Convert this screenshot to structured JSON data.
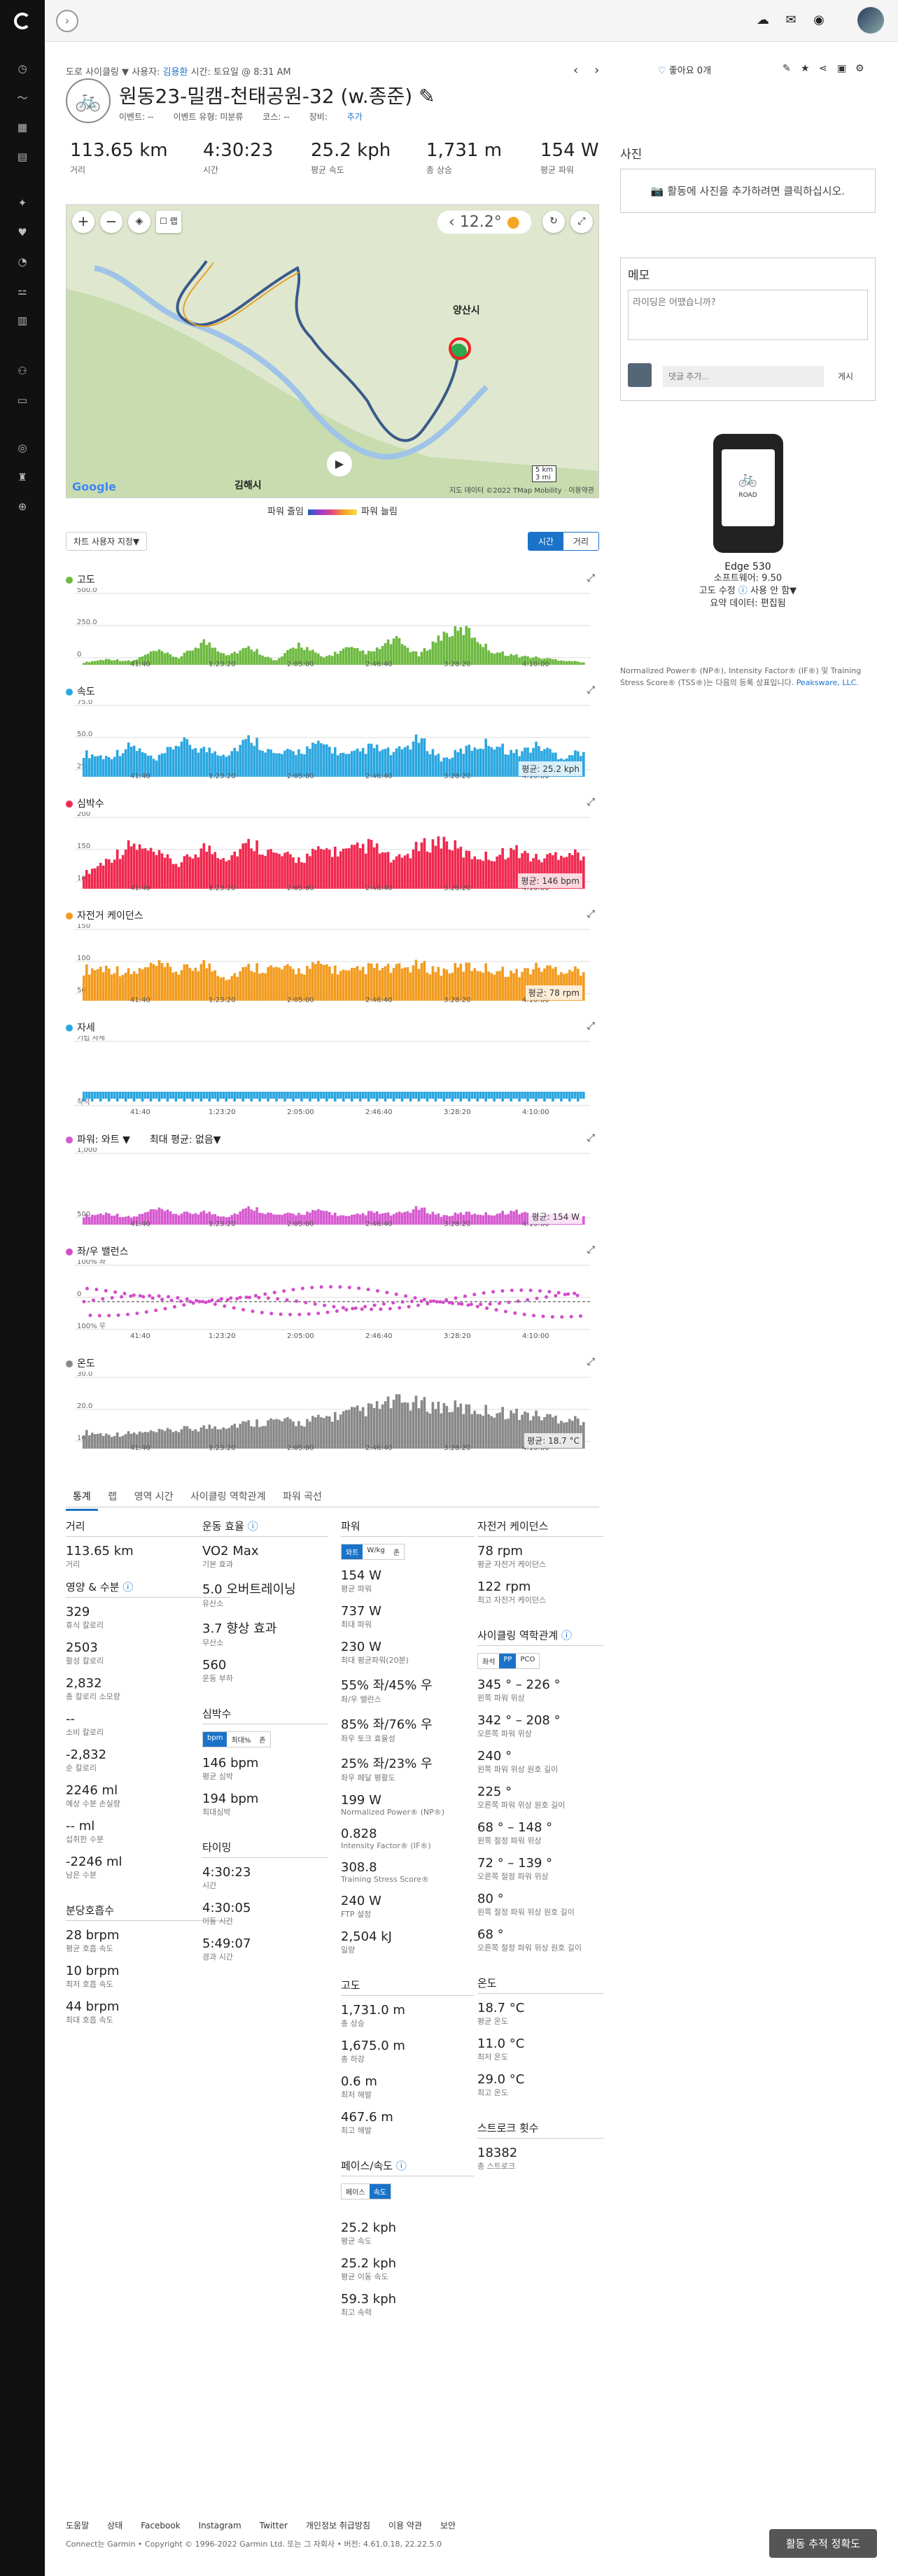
{
  "breadcrumb": {
    "type": "도로 사이클링",
    "sep": "▼",
    "user_prefix": "사용자:",
    "user": "김용환",
    "time": "시간: 토요일 @ 8:31 AM"
  },
  "activity": {
    "title": "원동23-밀캠-천태공원-32 (w.종준)",
    "event_type": "이벤트: --",
    "event_type_label": "이벤트 유형: 미분류",
    "course": "코스: --",
    "equipment_label": "장비:",
    "equipment_add": "추가"
  },
  "likes": "좋아요 0개",
  "stats": [
    {
      "value": "113.65 km",
      "label": "거리"
    },
    {
      "value": "4:30:23",
      "label": "시간"
    },
    {
      "value": "25.2 kph",
      "label": "평균 속도"
    },
    {
      "value": "1,731 m",
      "label": "총 상승"
    },
    {
      "value": "154 W",
      "label": "평균 파워"
    }
  ],
  "map": {
    "temp": "12.2°",
    "places": [
      "양산시",
      "김해시"
    ],
    "attribution": "지도 데이터 ©2022 TMap Mobility · 이용약관",
    "scale_km": "5 km",
    "scale_mi": "3 mi",
    "google": "Google"
  },
  "power_legend": {
    "left": "파워 줄임",
    "right": "파워 늘림"
  },
  "chart_controls": {
    "select": "차트 사용자 지정▼",
    "time": "시간",
    "distance": "거리"
  },
  "chart_data": [
    {
      "type": "area",
      "title": "고도",
      "color": "#6cb93f",
      "y_ticks": [
        "500.0",
        "250.0",
        "0"
      ],
      "x": [
        "41:40",
        "1:23:20",
        "2:05:00",
        "2:46:40",
        "3:28:20",
        "4:10:00"
      ],
      "values": [
        20,
        50,
        30,
        120,
        60,
        200,
        90,
        150,
        30,
        180,
        60,
        140,
        100,
        220,
        80,
        260,
        300,
        120,
        80,
        60,
        40,
        20
      ],
      "ylim": [
        0,
        500
      ]
    },
    {
      "type": "area",
      "title": "속도",
      "color": "#2aa6e0",
      "avg_label": "평균: 25.2 kph",
      "y_ticks": [
        "75.0",
        "50.0",
        "25.0"
      ],
      "x": [
        "41:40",
        "1:23:20",
        "2:05:00",
        "2:46:40",
        "3:28:20",
        "4:10:00"
      ],
      "values": [
        30,
        25,
        40,
        20,
        45,
        35,
        30,
        50,
        28,
        33,
        42,
        26,
        38,
        30,
        48,
        22,
        36,
        44,
        30,
        40,
        25,
        35
      ],
      "ylim": [
        0,
        75
      ]
    },
    {
      "type": "area",
      "title": "심박수",
      "color": "#f0284e",
      "avg_label": "평균: 146 bpm",
      "y_ticks": [
        "200",
        "150",
        "100"
      ],
      "x": [
        "41:40",
        "1:23:20",
        "2:05:00",
        "2:46:40",
        "3:28:20",
        "4:10:00"
      ],
      "values": [
        110,
        140,
        170,
        150,
        130,
        165,
        145,
        175,
        150,
        140,
        160,
        155,
        170,
        135,
        165,
        180,
        150,
        145,
        160,
        140,
        155,
        150
      ],
      "ylim": [
        80,
        200
      ]
    },
    {
      "type": "area",
      "title": "자전거 케이던스",
      "color": "#f29a1d",
      "avg_label": "평균: 78 rpm",
      "y_ticks": [
        "150",
        "100",
        "50"
      ],
      "x": [
        "41:40",
        "1:23:20",
        "2:05:00",
        "2:46:40",
        "3:28:20",
        "4:10:00"
      ],
      "values": [
        80,
        85,
        70,
        90,
        75,
        95,
        60,
        88,
        82,
        78,
        92,
        70,
        85,
        80,
        90,
        76,
        88,
        82,
        70,
        86,
        80,
        78
      ],
      "ylim": [
        0,
        150
      ]
    },
    {
      "type": "bar",
      "title": "자세",
      "color": "#2aa6e0",
      "y_ticks": [
        "기립 자세",
        "착석"
      ],
      "x": [
        "41:40",
        "1:23:20",
        "2:05:00",
        "2:46:40",
        "3:28:20",
        "4:10:00"
      ]
    },
    {
      "type": "area",
      "title": "파워: 와트 ▼",
      "subtitle": "최대 평균: 없음▼",
      "color": "#d65ad0",
      "avg_label": "평균: 154 W",
      "y_ticks": [
        "1,000",
        "500"
      ],
      "x": [
        "41:40",
        "1:23:20",
        "2:05:00",
        "2:46:40",
        "3:28:20",
        "4:10:00"
      ],
      "values": [
        150,
        200,
        120,
        260,
        180,
        220,
        140,
        300,
        160,
        190,
        240,
        130,
        210,
        170,
        280,
        150,
        200,
        180,
        230,
        160,
        190,
        150
      ],
      "ylim": [
        0,
        1000
      ]
    },
    {
      "type": "scatter",
      "title": "좌/우 밸런스",
      "color": "#d34bc9",
      "y_ticks": [
        "100% 좌",
        "0",
        "100% 우"
      ],
      "x": [
        "41:40",
        "1:23:20",
        "2:05:00",
        "2:46:40",
        "3:28:20",
        "4:10:00"
      ]
    },
    {
      "type": "area",
      "title": "온도",
      "color": "#888888",
      "avg_label": "평균: 18.7 °C",
      "y_ticks": [
        "30.0",
        "20.0",
        "10.0"
      ],
      "x": [
        "41:40",
        "1:23:20",
        "2:05:00",
        "2:46:40",
        "3:28:20",
        "4:10:00"
      ],
      "values": [
        12,
        11,
        11.5,
        12,
        13,
        14,
        15,
        16,
        17,
        16,
        18,
        20,
        22,
        25,
        24,
        23,
        22,
        21,
        20,
        19,
        18,
        17
      ],
      "ylim": [
        5,
        30
      ]
    }
  ],
  "tabs": [
    "통계",
    "랩",
    "영역 시간",
    "사이클링 역학관계",
    "파워 곡선"
  ],
  "col1": {
    "dist_h": "거리",
    "dist_v": "113.65 km",
    "dist_d": "거리",
    "nut_h": "영양 & 수분",
    "items": [
      {
        "v": "329",
        "d": "휴식 칼로리"
      },
      {
        "v": "2503",
        "d": "활성 칼로리"
      },
      {
        "v": "2,832",
        "d": "총 칼로리 소모량"
      },
      {
        "v": "--",
        "d": "소비 칼로리"
      },
      {
        "v": "-2,832",
        "d": "순 칼로리"
      },
      {
        "v": "2246 ml",
        "d": "예상 수분 손실량"
      },
      {
        "v": "-- ml",
        "d": "섭취한 수분"
      },
      {
        "v": "-2246 ml",
        "d": "남은 수분"
      }
    ],
    "resp_h": "분당호흡수",
    "resp": [
      {
        "v": "28 brpm",
        "d": "평균 호흡 속도"
      },
      {
        "v": "10 brpm",
        "d": "최저 호흡 속도"
      },
      {
        "v": "44 brpm",
        "d": "최대 호흡 속도"
      }
    ]
  },
  "col2": {
    "eff_h": "운동 효율",
    "eff": [
      {
        "v": "VO2 Max",
        "d": "기본 효과"
      },
      {
        "v": "5.0 오버트레이닝",
        "d": "유산소"
      },
      {
        "v": "3.7 향상 효과",
        "d": "무산소"
      },
      {
        "v": "560",
        "d": "운동 부하"
      }
    ],
    "hr_h": "심박수",
    "hr_toggle": [
      "bpm",
      "최대%",
      "존"
    ],
    "hr": [
      {
        "v": "146 bpm",
        "d": "평균 심박"
      },
      {
        "v": "194 bpm",
        "d": "최대심박"
      }
    ],
    "timing_h": "타이밍",
    "timing": [
      {
        "v": "4:30:23",
        "d": "시간"
      },
      {
        "v": "4:30:05",
        "d": "이동 시간"
      },
      {
        "v": "5:49:07",
        "d": "경과 시간"
      }
    ]
  },
  "col3": {
    "pw_h": "파워",
    "pw_toggle": [
      "와트",
      "W/kg",
      "존"
    ],
    "pw": [
      {
        "v": "154 W",
        "d": "평균 파워"
      },
      {
        "v": "737 W",
        "d": "최대 파워"
      },
      {
        "v": "230 W",
        "d": "최대 평균파워(20분)"
      },
      {
        "v": "55% 좌/45% 우",
        "d": "좌/우 밸런스"
      },
      {
        "v": "85% 좌/76% 우",
        "d": "좌우 토크 효율성"
      },
      {
        "v": "25% 좌/23% 우",
        "d": "좌우 페달 평활도"
      },
      {
        "v": "199 W",
        "d": "Normalized Power® (NP®)"
      },
      {
        "v": "0.828",
        "d": "Intensity Factor® (IF®)"
      },
      {
        "v": "308.8",
        "d": "Training Stress Score®"
      },
      {
        "v": "240 W",
        "d": "FTP 설정"
      },
      {
        "v": "2,504 kJ",
        "d": "일량"
      }
    ],
    "elev_h": "고도",
    "elev": [
      {
        "v": "1,731.0 m",
        "d": "총 상승"
      },
      {
        "v": "1,675.0 m",
        "d": "총 하강"
      },
      {
        "v": "0.6 m",
        "d": "최저 해발"
      },
      {
        "v": "467.6 m",
        "d": "최고 해발"
      }
    ],
    "pace_h": "페이스/속도",
    "pace_toggle": [
      "페이스",
      "속도"
    ],
    "pace": [
      {
        "v": "25.2 kph",
        "d": "평균 속도"
      },
      {
        "v": "25.2 kph",
        "d": "평균 이동 속도"
      },
      {
        "v": "59.3 kph",
        "d": "최고 속력"
      }
    ]
  },
  "col4": {
    "cad_h": "자전거 케이던스",
    "cad": [
      {
        "v": "78 rpm",
        "d": "평균 자전거 케이던스"
      },
      {
        "v": "122 rpm",
        "d": "최고 자전거 케이던스"
      }
    ],
    "dyn_h": "사이클링 역학관계",
    "dyn_toggle": [
      "좌석",
      "PP",
      "PCO"
    ],
    "dyn": [
      {
        "v": "345 ° – 226 °",
        "d": "왼쪽 파워 위상"
      },
      {
        "v": "342 ° – 208 °",
        "d": "오른쪽 파워 위상"
      },
      {
        "v": "240 °",
        "d": "왼쪽 파워 위상 원호 길이"
      },
      {
        "v": "225 °",
        "d": "오른쪽 파워 위상 원호 길이"
      },
      {
        "v": "68 ° – 148 °",
        "d": "왼쪽 절정 파워 위상"
      },
      {
        "v": "72 ° – 139 °",
        "d": "오른쪽 절정 파워 위상"
      },
      {
        "v": "80 °",
        "d": "왼쪽 절정 파워 위상 원호 길이"
      },
      {
        "v": "68 °",
        "d": "오른쪽 절정 파워 위상 원호 길이"
      }
    ],
    "temp_h": "온도",
    "temp": [
      {
        "v": "18.7 °C",
        "d": "평균 온도"
      },
      {
        "v": "11.0 °C",
        "d": "최저 온도"
      },
      {
        "v": "29.0 °C",
        "d": "최고 온도"
      }
    ],
    "stroke_h": "스트로크 횟수",
    "stroke": [
      {
        "v": "18382",
        "d": "총 스트로크"
      }
    ]
  },
  "right": {
    "photo_h": "사진",
    "photo_cta": "활동에 사진을 추가하려면 클릭하십시오.",
    "memo_h": "메모",
    "memo_ph": "라이딩은 어땠습니까?",
    "comment_ph": "댓글 추가...",
    "post": "게시",
    "device": "Edge 530",
    "sw": "소프트웨어: 9.50",
    "elev_fix": "고도 수정",
    "elev_fix_val": "사용 안 함▼",
    "summary": "요약 데이터: 편집됨",
    "note": "Normalized Power® (NP®), Intensity Factor® (IF®) 및 Training Stress Score® (TSS®)는 다음의 등록 상표입니다.",
    "note_link": "Peaksware, LLC."
  },
  "footer": {
    "links": [
      "도움말",
      "상태",
      "Facebook",
      "Instagram",
      "Twitter",
      "개인정보 취급방침",
      "이용 약관",
      "보안"
    ],
    "copy": "Connect는 Garmin • Copyright © 1996-2022 Garmin Ltd. 또는 그 자회사 • 버전: 4.61.0.18, 22.22.5.0",
    "accuracy_btn": "활동 추적 정확도"
  }
}
